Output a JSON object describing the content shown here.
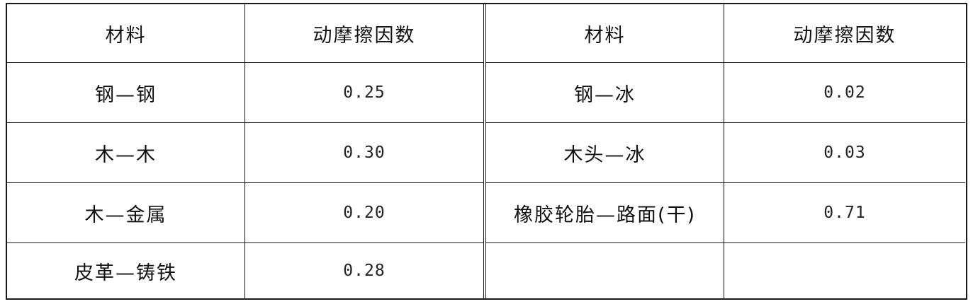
{
  "table": {
    "headers": [
      "材料",
      "动摩擦因数",
      "材料",
      "动摩擦因数"
    ],
    "rows": [
      [
        "钢—钢",
        "0.25",
        "钢—冰",
        "0.02"
      ],
      [
        "木—木",
        "0.30",
        "木头—冰",
        "0.03"
      ],
      [
        "木—金属",
        "0.20",
        "橡胶轮胎—路面(干)",
        "0.71"
      ],
      [
        "皮革—铸铁",
        "0.28",
        "",
        ""
      ]
    ]
  }
}
